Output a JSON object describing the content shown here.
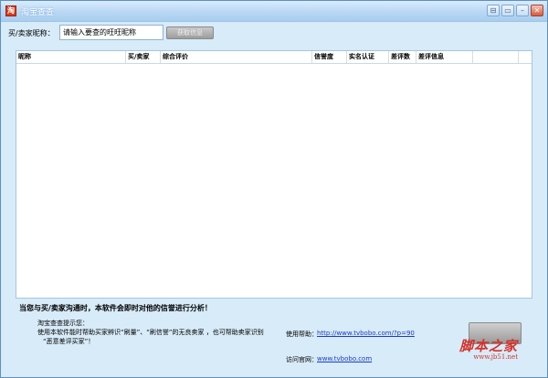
{
  "window": {
    "title": "淘宝查查"
  },
  "title_buttons": [
    "⊟",
    "▭",
    "–",
    "✕"
  ],
  "search": {
    "label": "买/卖家昵称：",
    "value": "请输入要查的旺旺昵称",
    "button_label": "获取信息"
  },
  "table": {
    "columns": [
      "昵称",
      "买/卖家",
      "综合评价",
      "信誉度",
      "实名认证",
      "差评数",
      "差评信息"
    ],
    "rows": []
  },
  "footer": {
    "prompt": "当您与买/卖家沟通时，本软件会即时对他的信誉进行分析！",
    "tips": [
      "淘宝查查提示您：",
      "使用本软件能时帮助买家辨识“刷量”、“刷信誉”的无良卖家 ，也可帮助卖家识别",
      "“恶意差评买家”！"
    ],
    "help_label": "使用帮助：",
    "help_url": "http://www.tvbobo.com/?p=90",
    "site_label": "访问官网：",
    "site_url": "www.tvbobo.com"
  },
  "watermark": {
    "text": "脚本之家",
    "sub": "www.jb51.net"
  },
  "colors": {
    "background": "#d7ebf8",
    "titlebar": "#b9d8f4",
    "link": "#1a3cc9",
    "watermark": "#d6322a"
  }
}
